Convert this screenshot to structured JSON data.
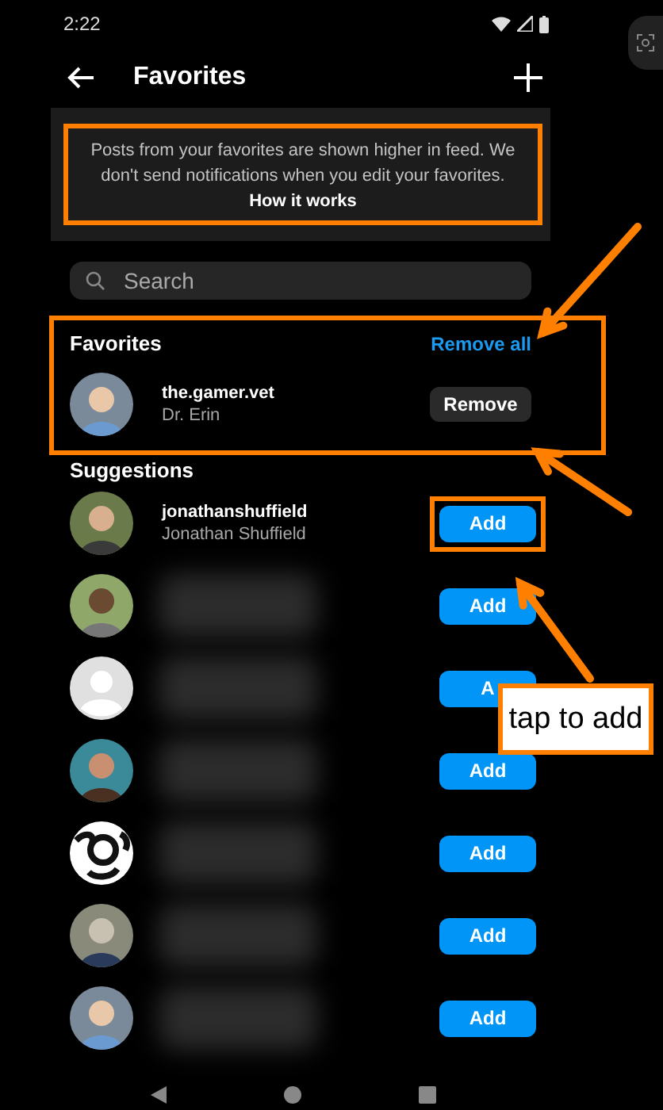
{
  "status_bar": {
    "time": "2:22"
  },
  "header": {
    "title": "Favorites"
  },
  "info": {
    "text": "Posts from your favorites are shown higher in feed. We don't send notifications when you edit your favorites.",
    "link": "How it works",
    "highlighted": true
  },
  "search": {
    "placeholder": "Search"
  },
  "favorites": {
    "title": "Favorites",
    "action": "Remove all",
    "highlighted": true,
    "items": [
      {
        "username": "the.gamer.vet",
        "full_name": "Dr. Erin",
        "button": "Remove"
      }
    ]
  },
  "suggestions": {
    "title": "Suggestions",
    "items": [
      {
        "username": "jonathanshuffield",
        "full_name": "Jonathan Shuffield",
        "button": "Add",
        "blurred": false,
        "highlighted": true
      },
      {
        "button": "Add",
        "blurred": true,
        "highlighted": false
      },
      {
        "button": "A",
        "avatar": {
          "kind": "placeholder"
        },
        "blurred": true,
        "highlighted": false
      },
      {
        "button": "Add",
        "blurred": true,
        "highlighted": false
      },
      {
        "button": "Add",
        "avatar": {
          "kind": "logo"
        },
        "blurred": true,
        "highlighted": false
      },
      {
        "button": "Add",
        "blurred": true,
        "highlighted": false
      },
      {
        "button": "Add",
        "blurred": true,
        "highlighted": false
      }
    ]
  },
  "callout": {
    "text": "tap to add"
  }
}
